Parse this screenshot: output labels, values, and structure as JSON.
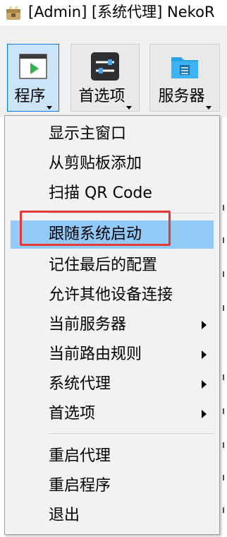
{
  "window": {
    "title": "[Admin] [系统代理] NekoR",
    "icon": "nekoray-app-icon"
  },
  "toolbar": {
    "buttons": [
      {
        "label": "程序",
        "icon": "terminal-play-icon",
        "active": true
      },
      {
        "label": "首选项",
        "icon": "sliders-icon",
        "active": false
      },
      {
        "label": "服务器",
        "icon": "folder-server-icon",
        "active": false
      }
    ]
  },
  "menu": {
    "items": {
      "show_main_window": "显示主窗口",
      "add_from_clipboard": "从剪贴板添加",
      "scan_qr": "扫描 QR Code",
      "start_with_system": "跟随系统启动",
      "remember_config": "记住最后的配置",
      "allow_lan": "允许其他设备连接",
      "current_server": "当前服务器",
      "current_routing": "当前路由规则",
      "system_proxy": "系统代理",
      "preferences": "首选项",
      "restart_proxy": "重启代理",
      "restart_program": "重启程序",
      "exit": "退出"
    },
    "highlighted": "start_with_system"
  },
  "colors": {
    "highlight": "#91c9f7",
    "active_button": "#cce4f7",
    "annotation": "#e53935"
  }
}
